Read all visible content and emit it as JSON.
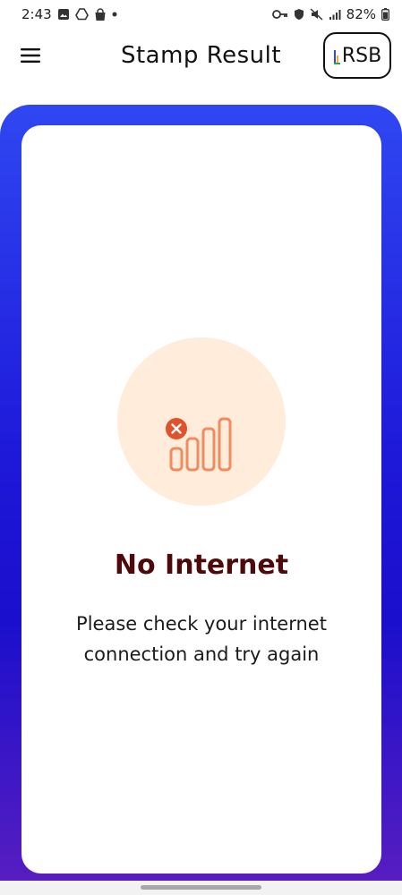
{
  "status_bar": {
    "time": "2:43",
    "battery": "82%",
    "left_icons": [
      "gallery-icon",
      "drive-icon",
      "shopping-bag-icon",
      "dot-icon"
    ],
    "right_icons": [
      "key-icon",
      "shield-icon",
      "mute-icon",
      "signal-icon",
      "battery-icon"
    ]
  },
  "app_bar": {
    "title": "Stamp Result",
    "menu_icon": "hamburger-menu-icon",
    "logo_text": "RSB"
  },
  "error": {
    "title": "No Internet",
    "message": "Please check your internet connection and try again",
    "icon": "no-signal-icon"
  },
  "colors": {
    "gradient_top": "#2f47f2",
    "gradient_mid": "#1a0fcc",
    "gradient_bottom": "#5a1ec0",
    "title_color": "#4e0a0a",
    "illustration_bg": "#ffecdb",
    "signal_bars": "#f28a5e",
    "error_dot": "#e0522a"
  }
}
